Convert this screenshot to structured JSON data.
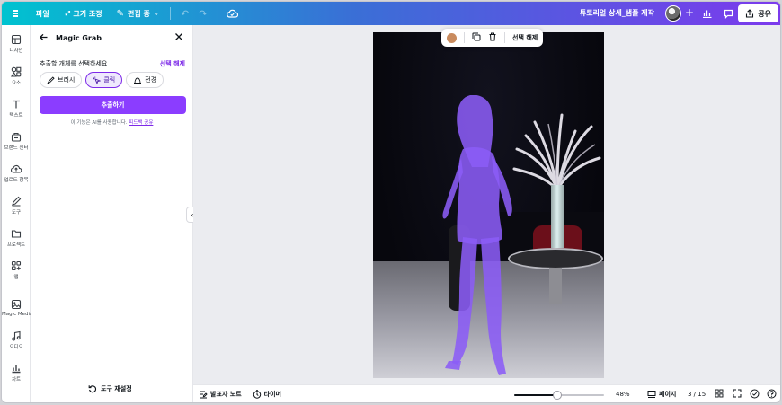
{
  "topbar": {
    "file": "파일",
    "resize": "크기 조정",
    "editing": "편집 중",
    "design_title": "튜토리얼 상세_샘플 제작",
    "share": "공유"
  },
  "rail": {
    "items": [
      {
        "label": "디자인",
        "icon": "layout-icon"
      },
      {
        "label": "요소",
        "icon": "shapes-icon"
      },
      {
        "label": "텍스트",
        "icon": "text-icon"
      },
      {
        "label": "브랜드 센터",
        "icon": "brand-icon"
      },
      {
        "label": "업로드 항목",
        "icon": "upload-icon"
      },
      {
        "label": "도구",
        "icon": "pen-tool-icon"
      },
      {
        "label": "프로젝트",
        "icon": "folder-icon"
      },
      {
        "label": "앱",
        "icon": "apps-icon"
      },
      {
        "label": "Magic Media",
        "icon": "magic-media-icon"
      },
      {
        "label": "오디오",
        "icon": "music-icon"
      },
      {
        "label": "차트",
        "icon": "chart-icon"
      }
    ]
  },
  "panel": {
    "title": "Magic Grab",
    "instruction": "추출할 개체를 선택하세요",
    "deselect": "선택 해제",
    "modes": [
      {
        "label": "브러시",
        "icon": "brush-icon",
        "active": false
      },
      {
        "label": "클릭",
        "icon": "click-icon",
        "active": true
      },
      {
        "label": "전경",
        "icon": "foreground-icon",
        "active": false
      }
    ],
    "extract_button": "추출하기",
    "ai_note": "이 기능은 AI를 사용합니다.",
    "ai_note_link": "피드백 공유",
    "reset_button": "도구 재설정"
  },
  "float_toolbar": {
    "color": "#c98b5e",
    "deselect": "선택 해제"
  },
  "bottombar": {
    "notes": "발표자 노트",
    "timer": "타이머",
    "zoom": "48%",
    "zoom_value": 0.48,
    "pages": "페이지",
    "page_count": "3 / 15"
  },
  "colors": {
    "accent": "#8b3dff",
    "selection": "#8b5cf6"
  }
}
